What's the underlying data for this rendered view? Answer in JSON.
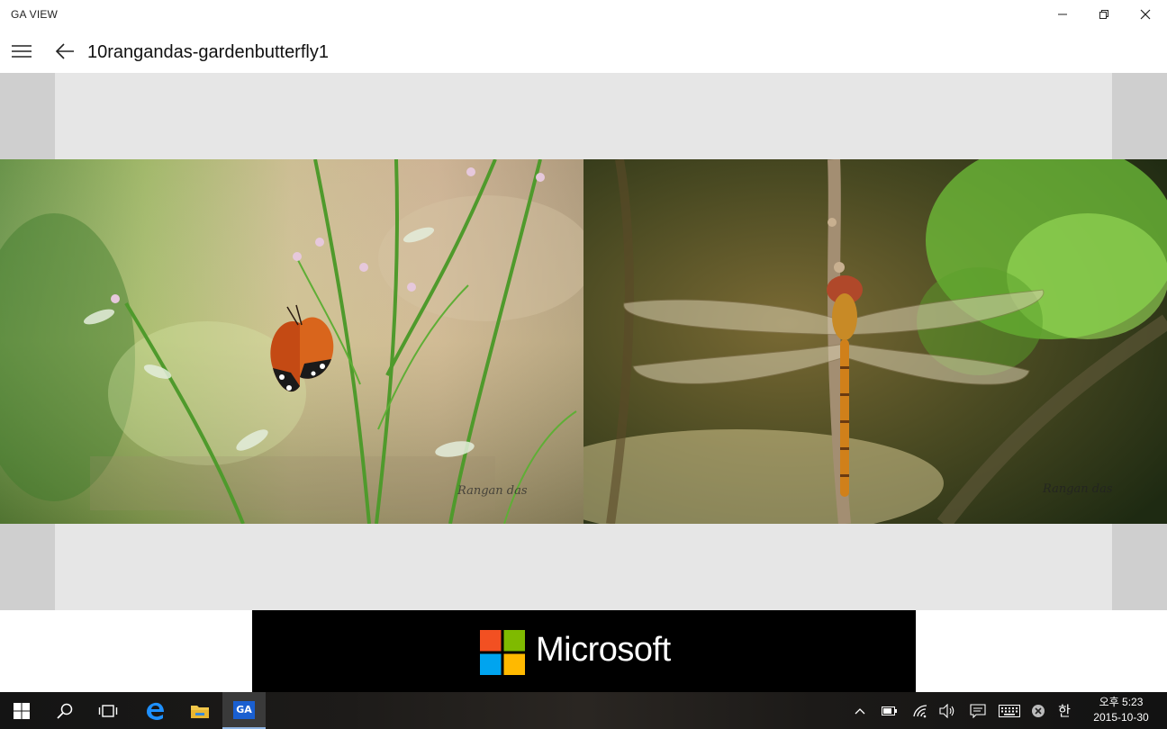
{
  "window": {
    "app_title": "GA VIEW"
  },
  "header": {
    "page_title": "10rangandas-gardenbutterfly1"
  },
  "photos": [
    {
      "subject": "butterfly",
      "watermark": "Rangan das"
    },
    {
      "subject": "dragonfly",
      "watermark": "Rangan das"
    }
  ],
  "ad": {
    "brand": "Microsoft"
  },
  "taskbar": {
    "pinned": [
      "start-icon",
      "search-icon",
      "task-view-icon",
      "edge-icon",
      "file-explorer-icon",
      "ga-view-app-icon"
    ],
    "ga_label": "GA",
    "ime_label": "한",
    "clock_time": "오후 5:23",
    "clock_date": "2015-10-30"
  },
  "colors": {
    "viewer_bg": "#e6e6e6",
    "viewer_side": "#cfcfcf",
    "ad_bg": "#000000",
    "ms_red": "#f25022",
    "ms_green": "#7fba00",
    "ms_blue": "#00a4ef",
    "ms_yellow": "#ffb900"
  }
}
